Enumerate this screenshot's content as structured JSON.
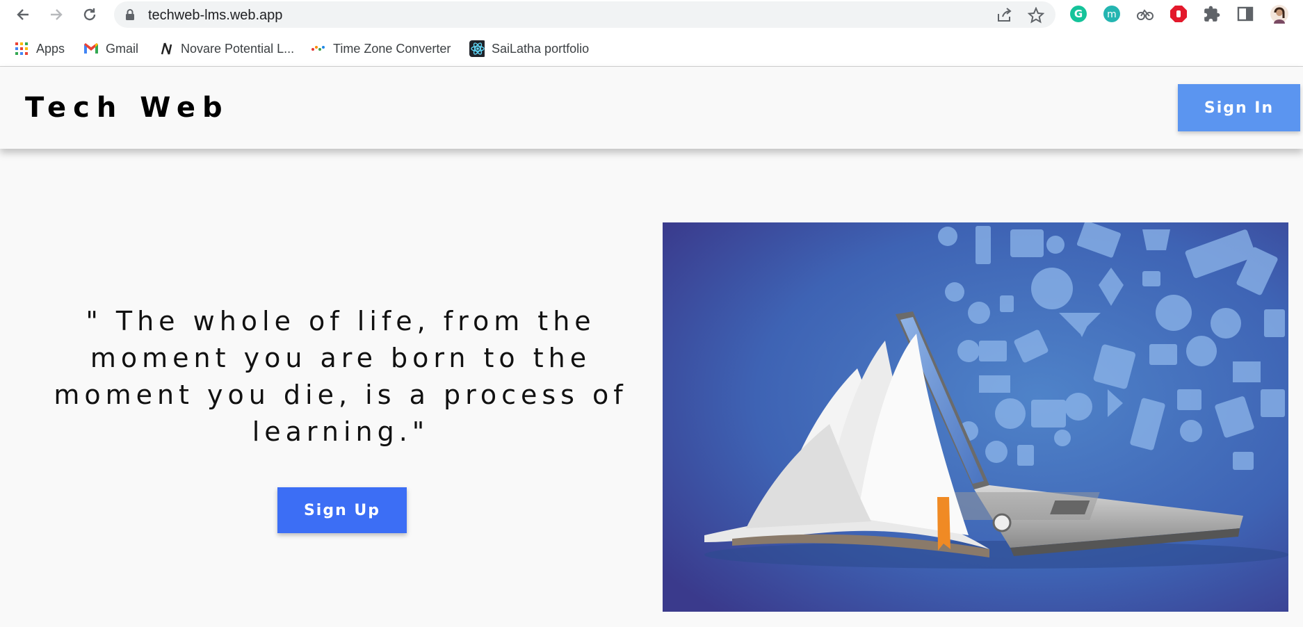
{
  "browser": {
    "url": "techweb-lms.web.app",
    "bookmarks": [
      {
        "label": "Apps",
        "icon": "apps-grid-icon"
      },
      {
        "label": "Gmail",
        "icon": "gmail-icon"
      },
      {
        "label": "Novare Potential L...",
        "icon": "novare-icon"
      },
      {
        "label": "Time Zone Converter",
        "icon": "timezone-icon"
      },
      {
        "label": "SaiLatha portfolio",
        "icon": "react-icon"
      }
    ]
  },
  "header": {
    "brand": "Tech Web",
    "signin_label": "Sign In"
  },
  "hero": {
    "quote": "\" The whole of life, from the moment you are born to the moment you die, is a process of learning.\"",
    "signup_label": "Sign Up"
  },
  "colors": {
    "signin_bg": "#5b95f0",
    "signup_bg": "#3c6ef5",
    "page_bg": "#f9f9f9"
  }
}
